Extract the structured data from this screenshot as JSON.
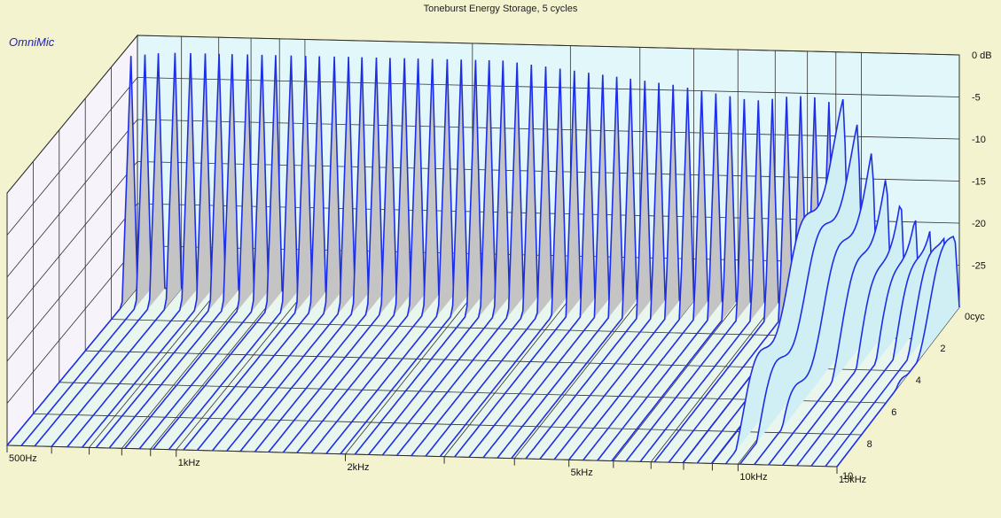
{
  "header": {
    "title": "Toneburst Energy Storage, 5 cycles",
    "brand": "OmniMic"
  },
  "chart_data": {
    "type": "waterfall",
    "title": "Toneburst Energy Storage, 5 cycles",
    "x_axis": {
      "scale": "log",
      "range": [
        500,
        15000
      ],
      "tick_labels": [
        {
          "value": 500,
          "label": "500Hz"
        },
        {
          "value": 1000,
          "label": "1kHz"
        },
        {
          "value": 2000,
          "label": "2kHz"
        },
        {
          "value": 5000,
          "label": "5kHz"
        },
        {
          "value": 10000,
          "label": "10kHz"
        },
        {
          "value": 15000,
          "label": "15kHz"
        }
      ]
    },
    "y_axis": {
      "unit": "dB",
      "range": [
        -30,
        0
      ],
      "tick_labels": [
        {
          "value": 0,
          "label": "0 dB"
        },
        {
          "value": -5,
          "label": "-5"
        },
        {
          "value": -10,
          "label": "-10"
        },
        {
          "value": -15,
          "label": "-15"
        },
        {
          "value": -20,
          "label": "-20"
        },
        {
          "value": -25,
          "label": "-25"
        }
      ]
    },
    "z_axis": {
      "unit": "cycles",
      "range": [
        0,
        10
      ],
      "tick_labels": [
        {
          "value": 0,
          "label": "0cyc"
        },
        {
          "value": 2,
          "label": "2"
        },
        {
          "value": 4,
          "label": "4"
        },
        {
          "value": 6,
          "label": "6"
        },
        {
          "value": 8,
          "label": "8"
        },
        {
          "value": 10,
          "label": "10"
        }
      ]
    },
    "slices": [
      {
        "freq": 500,
        "peak": -1.5
      },
      {
        "freq": 530,
        "peak": -1.3
      },
      {
        "freq": 560,
        "peak": -1.1
      },
      {
        "freq": 600,
        "peak": -1.0
      },
      {
        "freq": 640,
        "peak": -1.0
      },
      {
        "freq": 680,
        "peak": -1.0
      },
      {
        "freq": 720,
        "peak": -1.0
      },
      {
        "freq": 760,
        "peak": -1.0
      },
      {
        "freq": 810,
        "peak": -1.0
      },
      {
        "freq": 860,
        "peak": -1.0
      },
      {
        "freq": 910,
        "peak": -1.0
      },
      {
        "freq": 970,
        "peak": -1.0
      },
      {
        "freq": 1030,
        "peak": -1.0
      },
      {
        "freq": 1090,
        "peak": -1.0
      },
      {
        "freq": 1160,
        "peak": -1.0
      },
      {
        "freq": 1230,
        "peak": -1.0
      },
      {
        "freq": 1300,
        "peak": -1.0
      },
      {
        "freq": 1380,
        "peak": -1.0
      },
      {
        "freq": 1460,
        "peak": -1.0
      },
      {
        "freq": 1550,
        "peak": -1.0
      },
      {
        "freq": 1640,
        "peak": -1.0
      },
      {
        "freq": 1740,
        "peak": -1.0
      },
      {
        "freq": 1850,
        "peak": -1.0
      },
      {
        "freq": 1960,
        "peak": -1.0
      },
      {
        "freq": 2080,
        "peak": -1.0
      },
      {
        "freq": 2200,
        "peak": -1.0
      },
      {
        "freq": 2330,
        "peak": -1.0
      },
      {
        "freq": 2470,
        "peak": -1.2
      },
      {
        "freq": 2620,
        "peak": -1.4
      },
      {
        "freq": 2780,
        "peak": -1.6
      },
      {
        "freq": 2950,
        "peak": -1.8
      },
      {
        "freq": 3130,
        "peak": -2.0
      },
      {
        "freq": 3320,
        "peak": -2.2
      },
      {
        "freq": 3520,
        "peak": -2.4
      },
      {
        "freq": 3730,
        "peak": -2.6
      },
      {
        "freq": 3950,
        "peak": -2.8
      },
      {
        "freq": 4190,
        "peak": -3.0
      },
      {
        "freq": 4440,
        "peak": -3.2
      },
      {
        "freq": 4710,
        "peak": -3.4
      },
      {
        "freq": 5000,
        "peak": -3.7
      },
      {
        "freq": 5300,
        "peak": -4.0
      },
      {
        "freq": 5620,
        "peak": -4.3
      },
      {
        "freq": 5960,
        "peak": -4.6
      },
      {
        "freq": 6320,
        "peak": -4.9
      },
      {
        "freq": 6700,
        "peak": -5.0
      },
      {
        "freq": 7100,
        "peak": -4.8
      },
      {
        "freq": 7530,
        "peak": -4.5
      },
      {
        "freq": 7980,
        "peak": -4.4
      },
      {
        "freq": 8460,
        "peak": -4.5
      },
      {
        "freq": 8970,
        "peak": -5.0
      },
      {
        "freq": 9510,
        "peak": -6.5
      },
      {
        "freq": 10080,
        "peak": -9.0
      },
      {
        "freq": 10690,
        "peak": -11.5
      },
      {
        "freq": 11330,
        "peak": -13.5
      },
      {
        "freq": 12010,
        "peak": -15.5
      },
      {
        "freq": 12730,
        "peak": -17.0
      },
      {
        "freq": 13500,
        "peak": -18.5
      },
      {
        "freq": 14310,
        "peak": -19.5
      },
      {
        "freq": 15000,
        "peak": -20.0
      }
    ]
  }
}
